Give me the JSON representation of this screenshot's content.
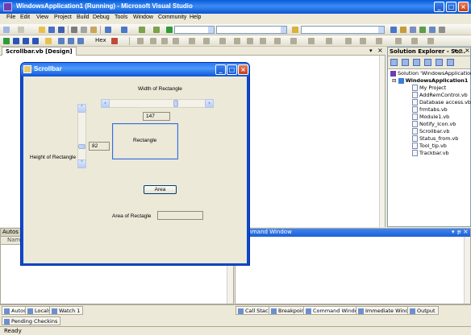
{
  "vs": {
    "title": "WindowsApplication1 (Running) - Microsoft Visual Studio",
    "menu": [
      "File",
      "Edit",
      "View",
      "Project",
      "Build",
      "Debug",
      "Tools",
      "Window",
      "Community",
      "Help"
    ],
    "hex_label": "Hex",
    "doc_tab": "Scrollbar.vb [Design]"
  },
  "solution_explorer": {
    "title": "Solution Explorer - So...",
    "solution": "Solution 'WindowsApplication1'",
    "project": "WindowsApplication1",
    "items": [
      "My Project",
      "AddRemControl.vb",
      "Database access.vb",
      "frmtabs.vb",
      "Module1.vb",
      "Notify_Icon.vb",
      "Scrollbar.vb",
      "Status_from.vb",
      "Tool_tip.vb",
      "Trackbar.vb"
    ]
  },
  "autos": {
    "title": "Autos",
    "col_name": "Name"
  },
  "command_window": {
    "title": "Command Window"
  },
  "bottom_tabs_left": [
    "Autos",
    "Locals",
    "Watch 1"
  ],
  "pending_tab": "Pending Checkins",
  "bottom_tabs_right": [
    "Call Stack",
    "Breakpoints",
    "Command Window",
    "Immediate Window",
    "Output"
  ],
  "status": "Ready",
  "form": {
    "title": "Scrollbar",
    "width_label": "Width of Rectangle",
    "width_value": "147",
    "height_label": "Height of Rectangle",
    "height_value": "82",
    "rect_label": "Rectangle",
    "area_button": "Area",
    "area_label": "Area of Rectagle",
    "area_value": ""
  }
}
